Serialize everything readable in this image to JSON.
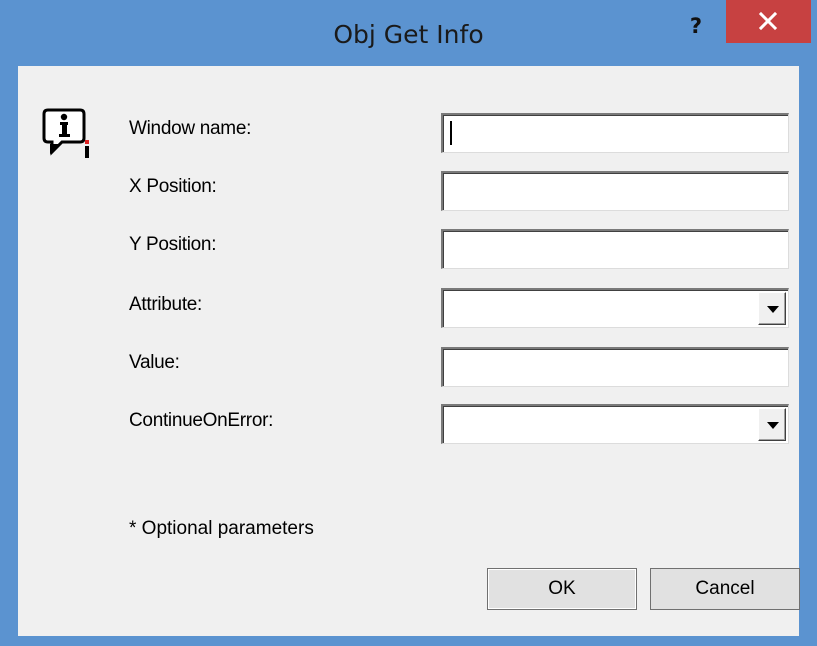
{
  "window": {
    "title": "Obj Get Info",
    "help_label": "?",
    "accent_color": "#5b93d0",
    "close_color": "#c74141"
  },
  "form": {
    "fields": [
      {
        "label": "Window name:",
        "value": "",
        "type": "text"
      },
      {
        "label": "X Position:",
        "value": "",
        "type": "text"
      },
      {
        "label": "Y Position:",
        "value": "",
        "type": "text"
      },
      {
        "label": "Attribute:",
        "value": "",
        "type": "dropdown"
      },
      {
        "label": "Value:",
        "value": "",
        "type": "text"
      },
      {
        "label": "ContinueOnError:",
        "value": "",
        "type": "dropdown"
      }
    ],
    "note": "*  Optional parameters"
  },
  "buttons": {
    "ok_label": "OK",
    "cancel_label": "Cancel"
  },
  "icons": {
    "info": "info-icon",
    "help": "help-icon",
    "close": "close-icon"
  }
}
